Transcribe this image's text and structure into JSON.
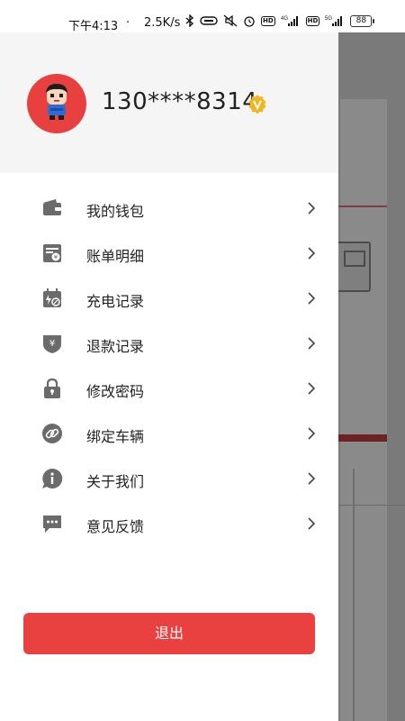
{
  "status_bar": {
    "time": "下午4:13",
    "dot": "·",
    "speed": "2.5K/s",
    "battery": "88",
    "icons": [
      "bluetooth-icon",
      "link-icon",
      "mute-icon",
      "alarm-icon",
      "hd-icon",
      "4g-signal-icon",
      "hd-icon",
      "5g-signal-icon",
      "battery-icon"
    ]
  },
  "profile": {
    "phone": "130****8314",
    "avatar_icon": "user-avatar-icon",
    "badge_icon": "vip-badge-icon"
  },
  "menu": {
    "items": [
      {
        "label": "我的钱包",
        "icon": "wallet-icon"
      },
      {
        "label": "账单明细",
        "icon": "bill-icon"
      },
      {
        "label": "充电记录",
        "icon": "charge-record-icon"
      },
      {
        "label": "退款记录",
        "icon": "refund-icon"
      },
      {
        "label": "修改密码",
        "icon": "lock-icon"
      },
      {
        "label": "绑定车辆",
        "icon": "link-icon"
      },
      {
        "label": "关于我们",
        "icon": "info-icon"
      },
      {
        "label": "意见反馈",
        "icon": "feedback-icon"
      }
    ]
  },
  "logout_label": "退出",
  "colors": {
    "accent": "#e94040",
    "icon": "#6b6b6b",
    "badge": "#f2b41f",
    "profile_bg": "#f5f5f5"
  }
}
